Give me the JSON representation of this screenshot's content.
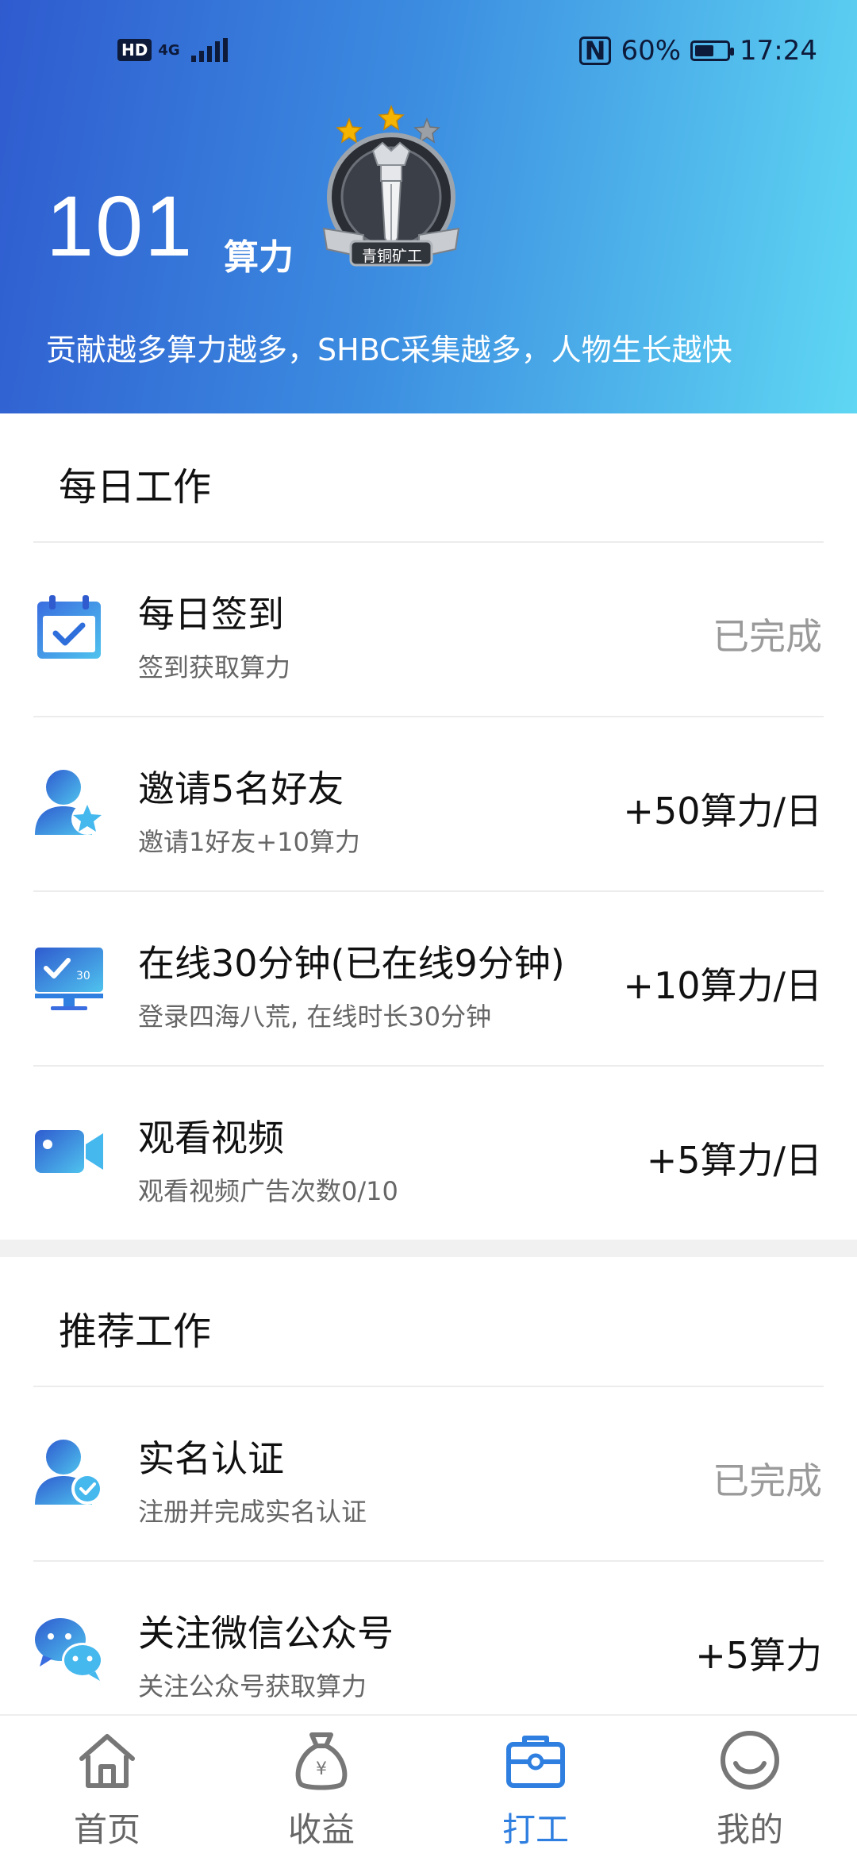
{
  "status_bar": {
    "left_badge": "HD",
    "network": "4G",
    "battery_percent": "60%",
    "battery_level": 0.6,
    "time": "17:24"
  },
  "header": {
    "power_value": "101",
    "power_unit": "算力",
    "rank_label": "青铜矿工",
    "tagline": "贡献越多算力越多，SHBC采集越多，人物生长越快"
  },
  "daily": {
    "title": "每日工作",
    "tasks": [
      {
        "icon": "calendar-check-icon",
        "title": "每日签到",
        "subtitle": "签到获取算力",
        "reward": "已完成",
        "done": true
      },
      {
        "icon": "user-star-icon",
        "title": "邀请5名好友",
        "subtitle": "邀请1好友+10算力",
        "reward": "+50算力/日",
        "done": false
      },
      {
        "icon": "monitor-icon",
        "title": "在线30分钟(已在线9分钟)",
        "subtitle": "登录四海八荒, 在线时长30分钟",
        "reward": "+10算力/日",
        "done": false
      },
      {
        "icon": "video-camera-icon",
        "title": "观看视频",
        "subtitle": "观看视频广告次数0/10",
        "reward": "+5算力/日",
        "done": false
      }
    ]
  },
  "recommended": {
    "title": "推荐工作",
    "tasks": [
      {
        "icon": "user-verified-icon",
        "title": "实名认证",
        "subtitle": "注册并完成实名认证",
        "reward": "已完成",
        "done": true
      },
      {
        "icon": "wechat-icon",
        "title": "关注微信公众号",
        "subtitle": "关注公众号获取算力",
        "reward": "+5算力",
        "done": false
      }
    ]
  },
  "nav": {
    "items": [
      {
        "label": "首页",
        "icon": "home-icon"
      },
      {
        "label": "收益",
        "icon": "money-bag-icon"
      },
      {
        "label": "打工",
        "icon": "toolbox-icon",
        "active": true
      },
      {
        "label": "我的",
        "icon": "smiley-icon"
      }
    ]
  },
  "colors": {
    "accent": "#2f7fe0",
    "header_start": "#2f5bcf",
    "header_end": "#5fd7f3",
    "done_text": "#9a9a9a"
  }
}
